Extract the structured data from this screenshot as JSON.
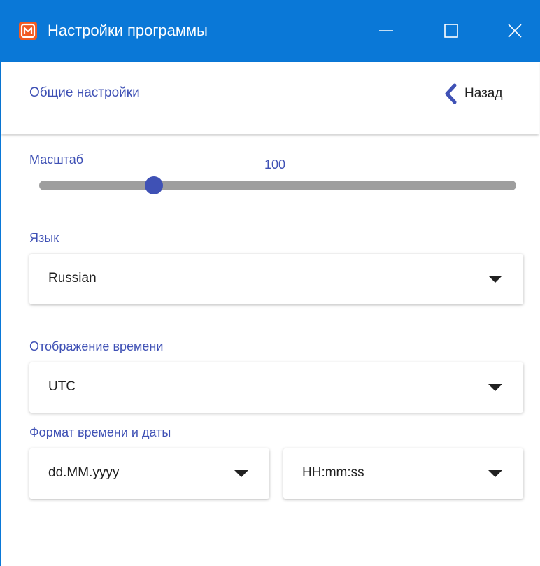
{
  "window": {
    "title": "Настройки программы",
    "app_icon": "app-logo-icon",
    "controls": [
      "minimize-icon",
      "maximize-icon",
      "close-icon"
    ],
    "accent_color": "#0a78d7"
  },
  "header": {
    "title": "Общие настройки",
    "back_label": "Назад",
    "back_icon": "chevron-left-icon"
  },
  "scale": {
    "label": "Масштаб",
    "value": "100",
    "position_fraction": 0.24
  },
  "language": {
    "label": "Язык",
    "selected": "Russian"
  },
  "time_display": {
    "label": "Отображение времени",
    "selected": "UTC"
  },
  "datetime_format": {
    "label": "Формат времени и даты",
    "date_selected": "dd.MM.yyyy",
    "time_selected": "HH:mm:ss"
  },
  "theme": {
    "primary": "#3f51b5",
    "track": "#9e9e9e"
  }
}
